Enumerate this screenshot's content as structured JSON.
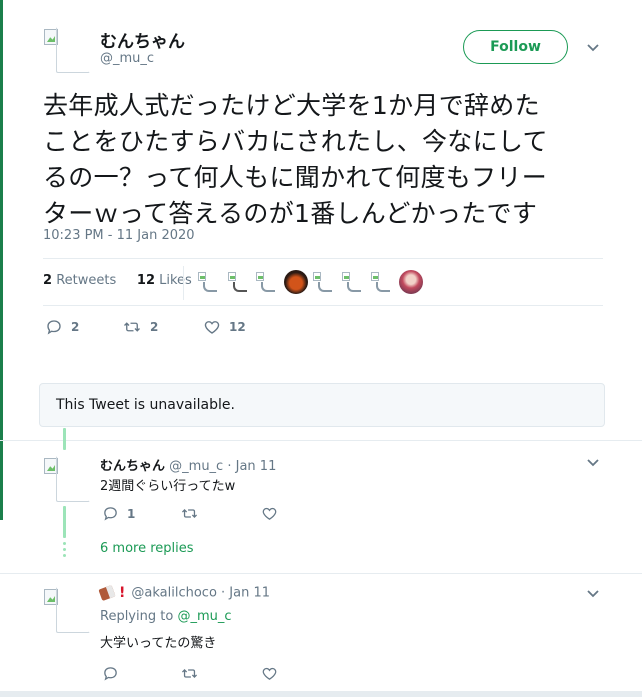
{
  "tweet": {
    "author_name": "むんちゃん",
    "author_handle": "@_mu_c",
    "follow_label": "Follow",
    "text_lines": [
      "去年成人式だったけど大学を1か月で辞めた",
      "ことをひたすらバカにされたし、今なにして",
      "るの一？って何人もに聞かれて何度もフリー",
      "ターｗって答えるのが1番しんどかったです"
    ],
    "timestamp": "10:23 PM - 11 Jan 2020",
    "retweets_count": "2",
    "retweets_label": "Retweets",
    "likes_count": "12",
    "likes_label": "Likes",
    "actions": {
      "reply_count": "2",
      "retweet_count": "2",
      "like_count": "12"
    }
  },
  "unavailable_notice": "This Tweet is unavailable.",
  "replies": [
    {
      "name": "むんちゃん",
      "handle": "@_mu_c",
      "date": "· Jan 11",
      "text": "2週間ぐらい行ってたw",
      "reply_count": "1"
    },
    {
      "handle": "@akalilchoco",
      "date": "· Jan 11",
      "replying_prefix": "Replying to",
      "replying_to": "@_mu_c",
      "text": "大学いってたの驚き"
    }
  ],
  "more_replies_label": "6 more replies",
  "icons": [
    "reply-icon",
    "retweet-icon",
    "heart-icon",
    "chevron-down-icon",
    "chocolate-emoji",
    "exclamation-emoji"
  ],
  "colors": {
    "accent": "#1b9a55",
    "muted": "#657786",
    "thread_line": "#9ce4b8"
  }
}
